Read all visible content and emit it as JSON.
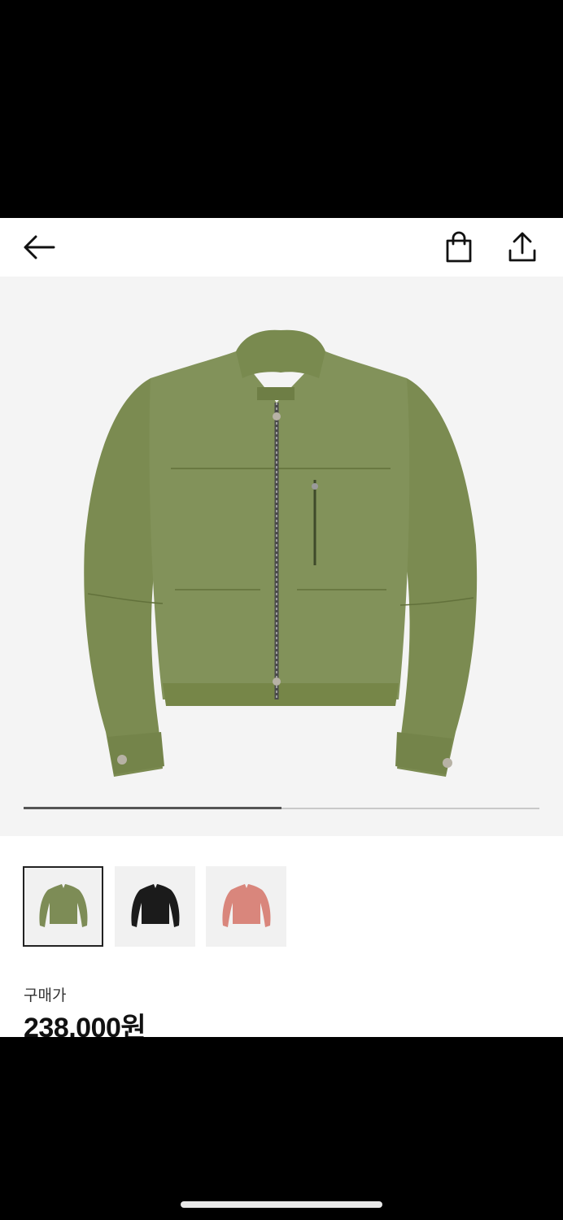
{
  "nav": {
    "back_icon": "arrow-left-icon",
    "bag_icon": "shopping-bag-icon",
    "share_icon": "share-upload-icon"
  },
  "gallery": {
    "carousel_position": 0.5,
    "thumbnails": [
      {
        "name": "olive",
        "color": "#7d8c56",
        "selected": true
      },
      {
        "name": "black",
        "color": "#1b1b1b",
        "selected": false
      },
      {
        "name": "pink",
        "color": "#d9867c",
        "selected": false
      }
    ]
  },
  "product": {
    "price_label": "구매가",
    "price": "238,000원"
  },
  "colors": {
    "jacket_main": "#7f8f55",
    "jacket_dark": "#6a7a45",
    "background": "#f4f4f4"
  }
}
